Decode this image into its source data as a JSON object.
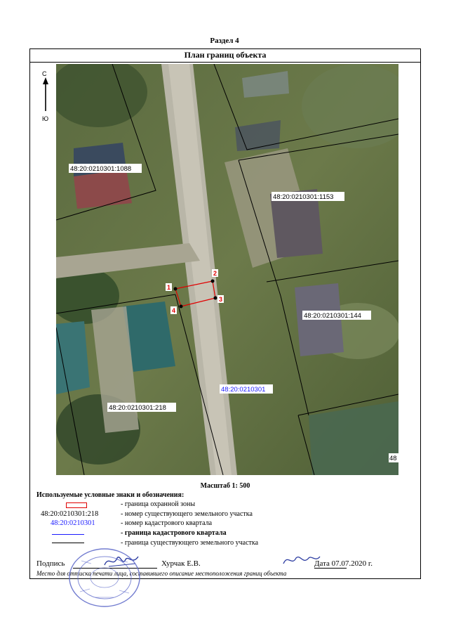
{
  "section_title": "Раздел 4",
  "plan_title": "План границ объекта",
  "compass": {
    "north": "С",
    "south": "Ю"
  },
  "map": {
    "parcels": [
      {
        "id": "48:20:0210301:1088"
      },
      {
        "id": "48:20:0210301:1153"
      },
      {
        "id": "48:20:0210301:144"
      },
      {
        "id": "48:20:0210301:218"
      },
      {
        "id": "48"
      }
    ],
    "kvartal": "48:20:0210301",
    "points": [
      "1",
      "2",
      "3",
      "4"
    ]
  },
  "scale": "Масштаб 1: 500",
  "legend": {
    "title": "Используемые условные знаки и обозначения:",
    "items": [
      {
        "symbol_text": "",
        "desc": "- граница  охранной зоны"
      },
      {
        "symbol_text": "48:20:0210301:218",
        "desc": "- номер существующего земельного участка"
      },
      {
        "symbol_text": "48:20:0210301",
        "desc": "- номер кадастрового квартала"
      },
      {
        "symbol_text": "",
        "desc": "- граница кадастрового квартала"
      },
      {
        "symbol_text": "",
        "desc": "- граница существующего земельного участка"
      }
    ]
  },
  "signature": {
    "label": "Подпись",
    "name": "Хурчак Е.В.",
    "date": "Дата 07.07.2020 г."
  },
  "footer_note": "Место для оттиска печати лица, составившего описание местоположения границ объекта",
  "colors": {
    "zone_border": "#e00000",
    "kvartal": "#1a1aff"
  }
}
